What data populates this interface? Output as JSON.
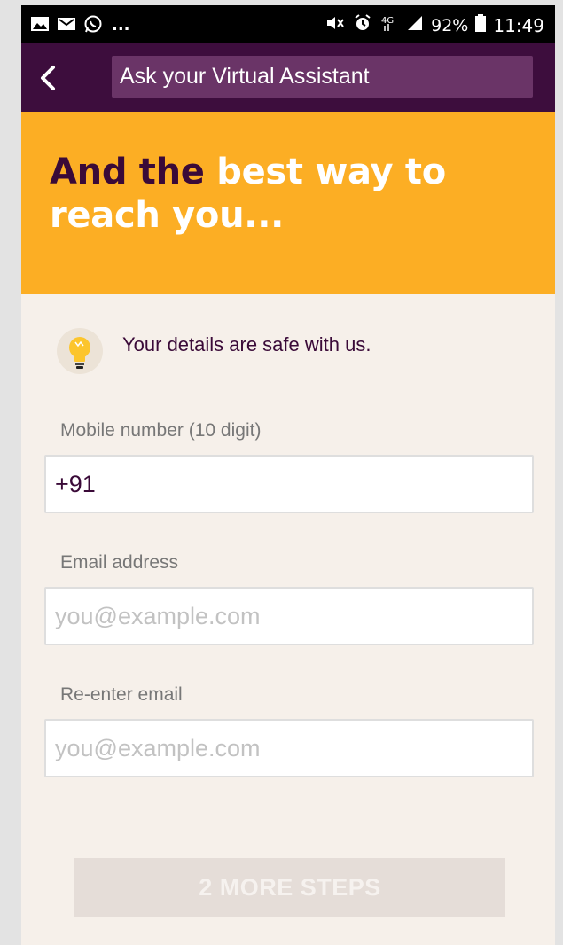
{
  "status_bar": {
    "ellipsis": "...",
    "battery": "92%",
    "time": "11:49",
    "network": "4G",
    "icons": [
      "gallery-icon",
      "mail-icon",
      "whatsapp-icon",
      "mute-icon",
      "alarm-icon",
      "signal-icon",
      "battery-icon"
    ]
  },
  "app_bar": {
    "search_text": "Ask your Virtual Assistant",
    "background": "#3d0d3d"
  },
  "hero": {
    "title_dark": "And the ",
    "title_highlight": "best way to reach you...",
    "background": "#fcae24"
  },
  "safe_note": {
    "text": "Your details are safe with us.",
    "icon": "lightbulb-icon"
  },
  "form": {
    "mobile_label": "Mobile number (10 digit)",
    "mobile_value": "+91",
    "email_label": "Email address",
    "email_placeholder": "you@example.com",
    "reenter_label": "Re-enter email",
    "reenter_placeholder": "you@example.com"
  },
  "submit": {
    "label": "2 MORE STEPS"
  },
  "colors": {
    "brand_purple": "#3d0d3d",
    "accent_orange": "#fcae24",
    "page_background": "#f6f0ea"
  }
}
